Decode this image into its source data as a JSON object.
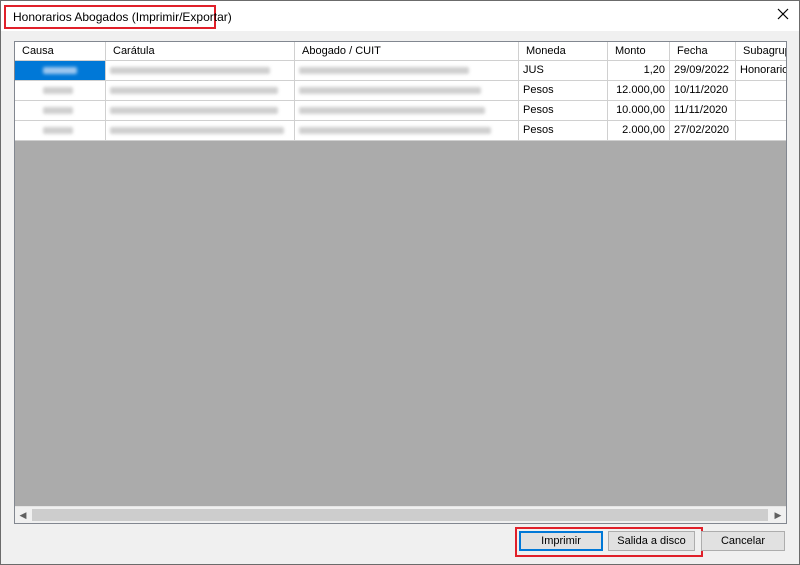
{
  "window": {
    "title": "Honorarios Abogados (Imprimir/Exportar)"
  },
  "grid": {
    "columns": [
      "Causa",
      "Carátula",
      "Abogado / CUIT",
      "Moneda",
      "Monto",
      "Fecha",
      "Subagrupa"
    ],
    "rows": [
      {
        "moneda": "JUS",
        "monto": "1,20",
        "fecha": "29/09/2022",
        "subagrupa": "Honorario a"
      },
      {
        "moneda": "Pesos",
        "monto": "12.000,00",
        "fecha": "10/11/2020",
        "subagrupa": ""
      },
      {
        "moneda": "Pesos",
        "monto": "10.000,00",
        "fecha": "11/11/2020",
        "subagrupa": ""
      },
      {
        "moneda": "Pesos",
        "monto": "2.000,00",
        "fecha": "27/02/2020",
        "subagrupa": ""
      }
    ]
  },
  "buttons": {
    "print": "Imprimir",
    "save": "Salida a disco",
    "cancel": "Cancelar"
  },
  "colors": {
    "highlight": "#e0202a",
    "selection": "#0078d7",
    "grid_background": "#ababab"
  },
  "icons": {
    "close": "close-icon",
    "scroll_left": "chevron-left-icon",
    "scroll_right": "chevron-right-icon"
  }
}
